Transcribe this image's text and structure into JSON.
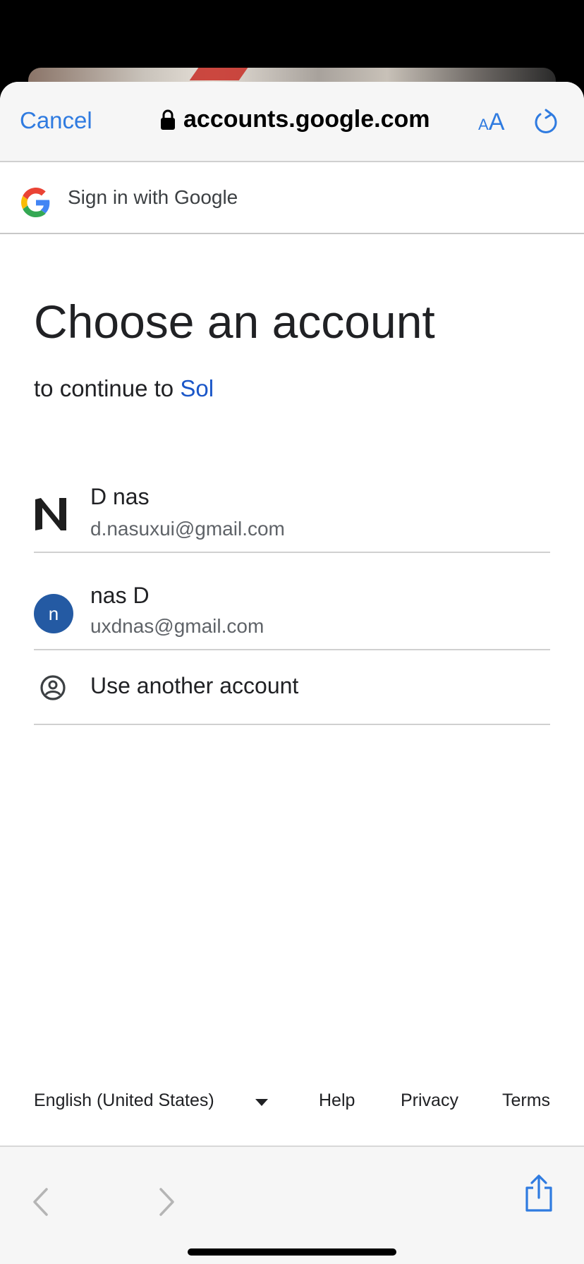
{
  "browser": {
    "cancel_label": "Cancel",
    "url": "accounts.google.com",
    "text_size_label_small": "A",
    "text_size_label_large": "A",
    "accent_color": "#2f7be0"
  },
  "header": {
    "text": "Sign in with Google"
  },
  "main": {
    "title": "Choose an account",
    "subtitle_prefix": "to continue to",
    "app_name": "Sol"
  },
  "accounts": [
    {
      "name": "D nas",
      "email": "d.nasuxui@gmail.com",
      "avatar": "N"
    },
    {
      "name": "nas D",
      "email": "uxdnas@gmail.com",
      "avatar": "n",
      "avatar_color": "#245aa3"
    }
  ],
  "another_account_label": "Use another account",
  "footer": {
    "language": "English (United States)",
    "help": "Help",
    "privacy": "Privacy",
    "terms": "Terms"
  },
  "icons": [
    "lock-icon",
    "text-size-icon",
    "reload-icon",
    "google-logo-icon",
    "person-circle-icon",
    "back-chevron-icon",
    "forward-chevron-icon",
    "share-icon"
  ]
}
